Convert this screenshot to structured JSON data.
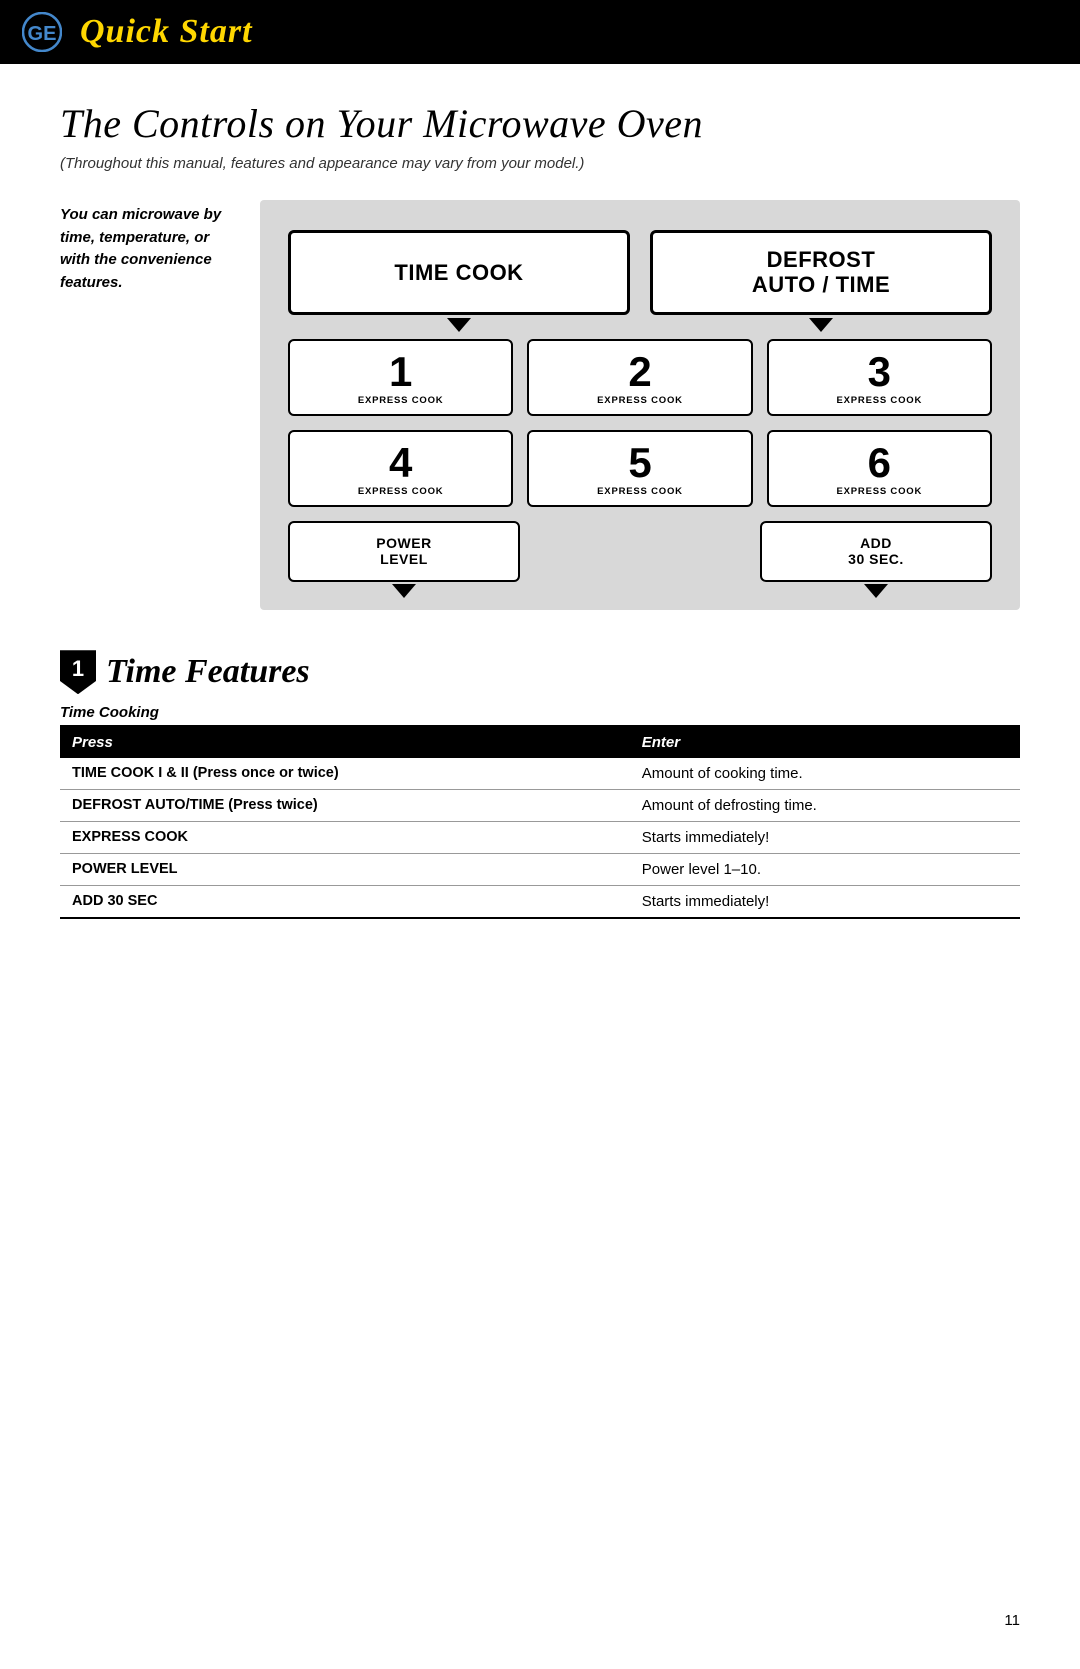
{
  "header": {
    "title": "Quick Start",
    "icon_label": "GE-icon"
  },
  "page": {
    "title": "The Controls on Your Microwave Oven",
    "subtitle": "(Throughout this manual, features and appearance may vary from your model.)",
    "side_note": "You can microwave by time, temperature, or with the convenience features.",
    "page_number": "11"
  },
  "control_panel": {
    "top_buttons": [
      {
        "label": "TIME COOK",
        "id": "time-cook"
      },
      {
        "label": "DEFROST\nAUTO / TIME",
        "id": "defrost-auto-time"
      }
    ],
    "number_buttons": [
      {
        "number": "1",
        "sublabel": "EXPRESS COOK"
      },
      {
        "number": "2",
        "sublabel": "EXPRESS COOK"
      },
      {
        "number": "3",
        "sublabel": "EXPRESS COOK"
      },
      {
        "number": "4",
        "sublabel": "EXPRESS COOK"
      },
      {
        "number": "5",
        "sublabel": "EXPRESS COOK"
      },
      {
        "number": "6",
        "sublabel": "EXPRESS COOK"
      }
    ],
    "bottom_buttons": [
      {
        "label": "POWER\nLEVEL",
        "id": "power-level",
        "has_arrow": true
      },
      {
        "label": "ADD\n30 SEC.",
        "id": "add-30-sec",
        "has_arrow": true
      }
    ]
  },
  "section1": {
    "number": "1",
    "title": "Time Features",
    "subsection": "Time Cooking",
    "table": {
      "headers": [
        "Press",
        "Enter"
      ],
      "rows": [
        {
          "press": "TIME COOK I & II (Press once or twice)",
          "enter": "Amount of cooking time."
        },
        {
          "press": "DEFROST AUTO/TIME (Press twice)",
          "enter": "Amount of defrosting time."
        },
        {
          "press": "EXPRESS COOK",
          "enter": "Starts immediately!"
        },
        {
          "press": "POWER LEVEL",
          "enter": "Power level 1–10."
        },
        {
          "press": "ADD 30 SEC",
          "enter": "Starts immediately!"
        }
      ]
    }
  }
}
